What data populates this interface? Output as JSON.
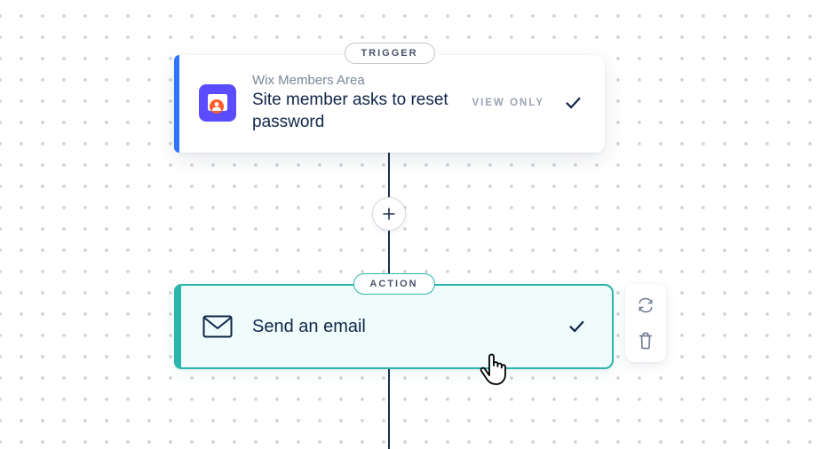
{
  "trigger": {
    "badge": "TRIGGER",
    "eyebrow": "Wix Members Area",
    "title": "Site member asks to reset password",
    "viewOnlyLabel": "VIEW ONLY",
    "accentColor": "#2f74ff",
    "iconBg": "#5b4cff"
  },
  "action": {
    "badge": "ACTION",
    "title": "Send an email",
    "accentColor": "#2cb5ac",
    "selected": true
  },
  "addButton": {
    "symbol": "+"
  },
  "toolbar": {
    "replaceTooltip": "Replace",
    "deleteTooltip": "Delete"
  }
}
